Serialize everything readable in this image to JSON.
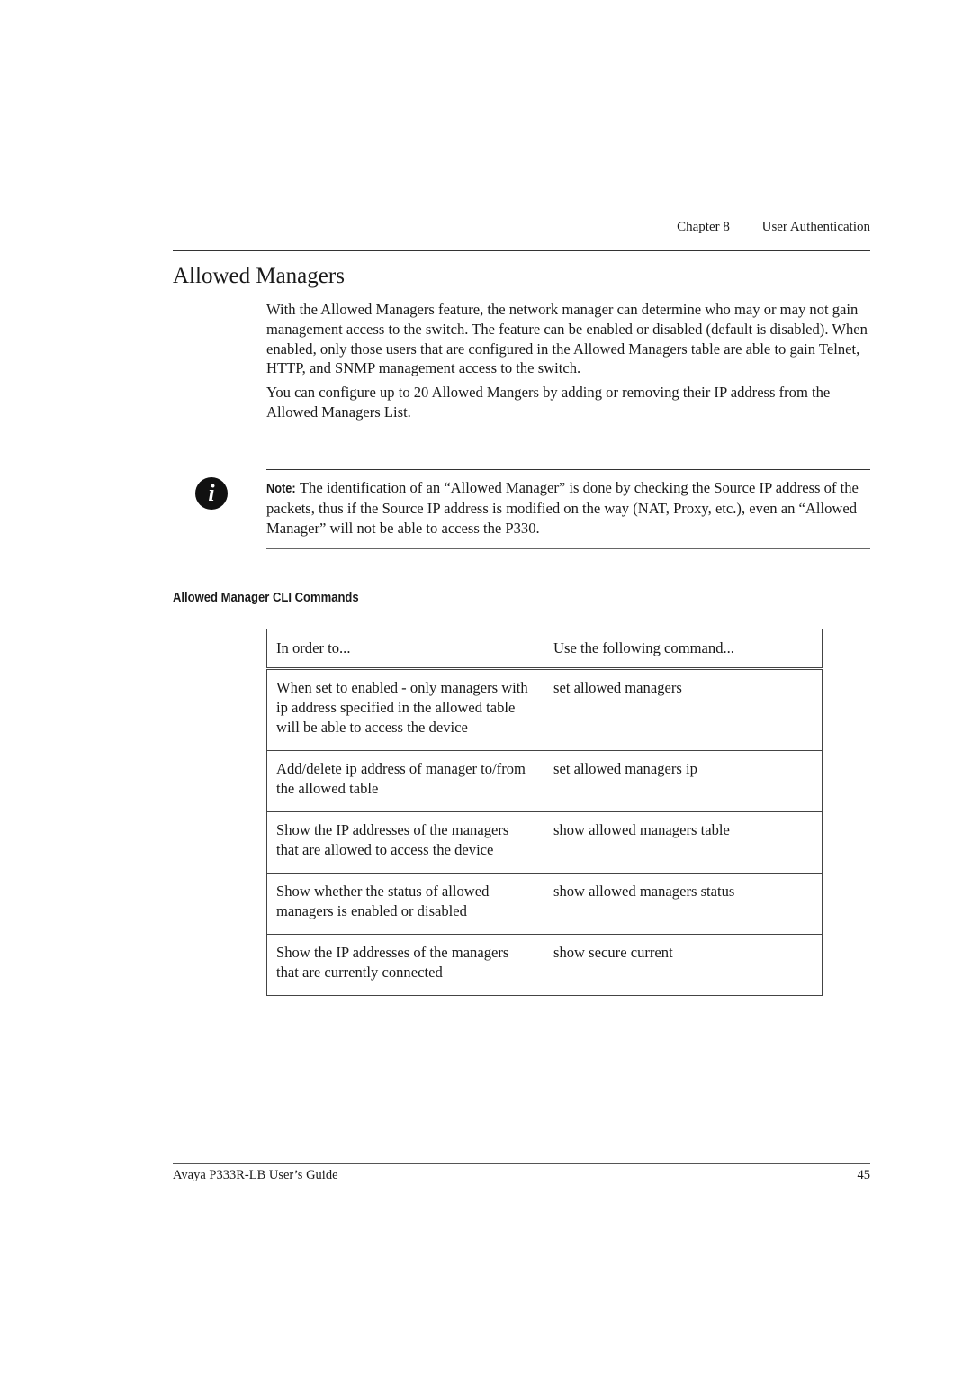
{
  "header": {
    "chapter": "Chapter 8",
    "section": "User Authentication"
  },
  "title": "Allowed Managers",
  "paragraphs": [
    "With the Allowed Managers feature, the network manager can determine who may or may not gain management access to the switch. The feature can be enabled or disabled (default is disabled). When enabled, only those users that are configured in the Allowed Managers table are able to gain Telnet, HTTP, and SNMP management access to the switch.",
    "You can configure up to 20 Allowed Mangers by adding or removing their IP address from the Allowed Managers List."
  ],
  "note": {
    "icon": "info-icon",
    "icon_glyph": "i",
    "label": "Note:",
    "text": "The identification of an “Allowed Manager” is done by checking the Source IP address of the packets, thus if the Source IP address is modified on the way (NAT, Proxy, etc.), even an “Allowed Manager” will not be able to access the P330."
  },
  "subheading": "Allowed Manager CLI Commands",
  "table": {
    "headers": [
      "In order to...",
      "Use the following command..."
    ],
    "rows": [
      {
        "purpose": "When set to enabled - only managers with ip address specified in the allowed table will be able to access the device",
        "command": "set allowed managers"
      },
      {
        "purpose": "Add/delete ip address of manager to/from the allowed table",
        "command": "set allowed managers ip"
      },
      {
        "purpose": "Show the IP addresses of the managers that are allowed to access the device",
        "command": "show allowed managers table"
      },
      {
        "purpose": "Show whether the status of allowed managers is enabled or disabled",
        "command": "show allowed managers status"
      },
      {
        "purpose": "Show the IP addresses of the managers that are currently connected",
        "command": "show secure current"
      }
    ]
  },
  "footer": {
    "guide": "Avaya P333R-LB User’s Guide",
    "page": "45"
  }
}
